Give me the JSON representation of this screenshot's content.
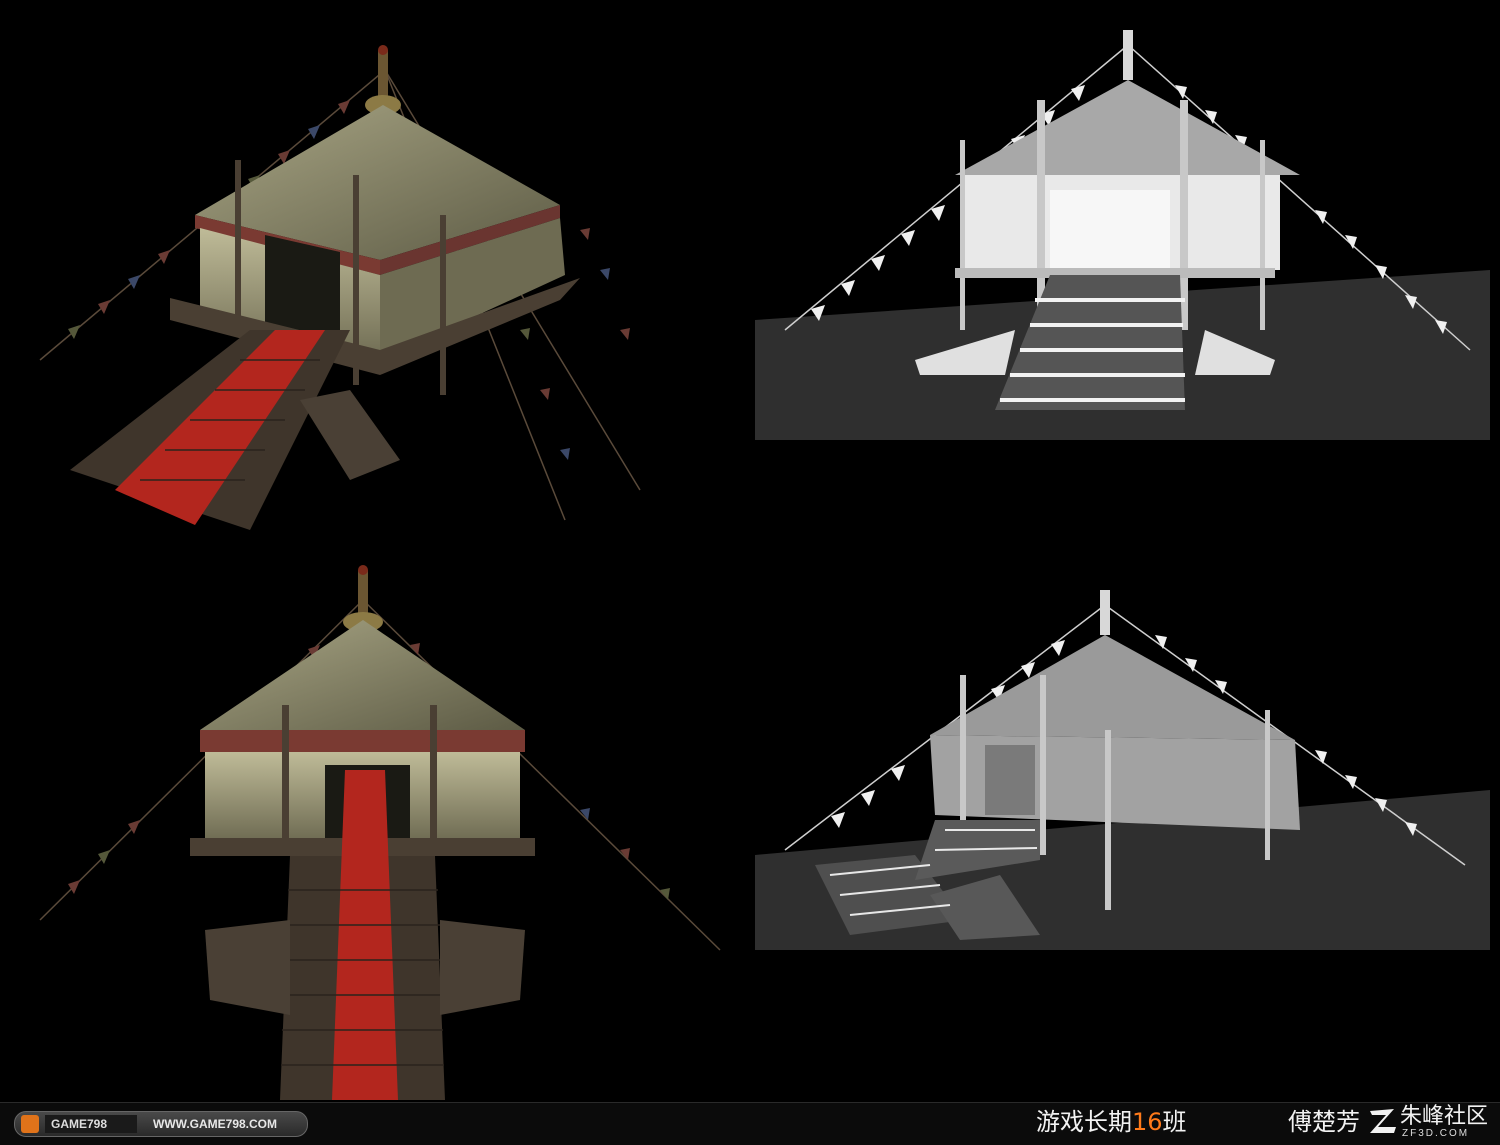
{
  "footer": {
    "watermark_brand": "GAME798",
    "watermark_url": "WWW.GAME798.COM",
    "class_label_prefix": "游戏长期",
    "class_label_number": "16",
    "class_label_suffix": "班",
    "author": "傅楚芳",
    "site_name": "朱峰社区",
    "site_url": "ZF3D.COM"
  },
  "colors": {
    "background": "#000000",
    "canvas_textured": "#b9b58f",
    "carpet": "#b3261e",
    "wood": "#4a3f33",
    "render_ground": "#2f2f2f",
    "render_tent": "#e9e9e9",
    "accent_orange": "#ff7a1a"
  },
  "scenes": [
    {
      "name": "textured-tent-perspective",
      "style": "textured"
    },
    {
      "name": "clay-render-front",
      "style": "untextured"
    },
    {
      "name": "textured-tent-front",
      "style": "textured"
    },
    {
      "name": "clay-render-side",
      "style": "untextured"
    }
  ]
}
